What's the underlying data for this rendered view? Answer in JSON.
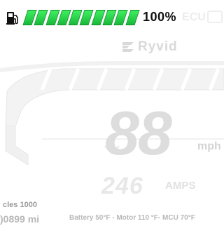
{
  "status": {
    "charge_percent": 100,
    "charge_label": "100%",
    "segments": 10,
    "ecu_label": "ECU",
    "bar_color": "#22c443"
  },
  "brand": {
    "name": "Ryvid",
    "logo_icon": "ryvid-logo-icon"
  },
  "speed": {
    "value": "88",
    "unit": "mph"
  },
  "current": {
    "value": "246",
    "unit": "AMPS"
  },
  "stats": {
    "cycles": "cles 1000",
    "odometer": ")0899 mi",
    "temps": "Battery 50°F - Motor 110 °F- MCU 70°F"
  },
  "icons": {
    "fuel": "fuel-pump-icon",
    "battery": "battery-icon"
  }
}
